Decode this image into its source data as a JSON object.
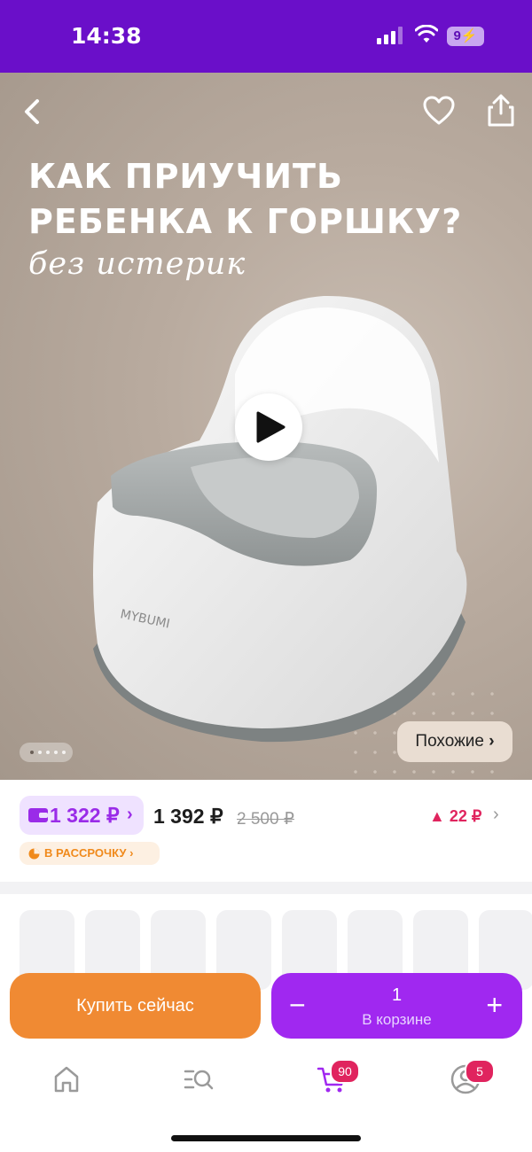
{
  "status_bar": {
    "time": "14:38",
    "battery": "9"
  },
  "hero": {
    "title": "КАК ПРИУЧИТЬ РЕБЕНКА К ГОРШКУ?",
    "subtitle": "без истерик",
    "brand_on_image": "MYBUMI",
    "similar_label": "Похожие",
    "pager_count": 5,
    "pager_active": 0
  },
  "price": {
    "wallet_price": "1 322 ₽",
    "current": "1 392 ₽",
    "old": "2 500 ₽",
    "delta": "22 ₽",
    "installment": "В РАССРОЧКУ"
  },
  "actions": {
    "buy_now": "Купить сейчас",
    "quantity": "1",
    "in_cart": "В корзине"
  },
  "tabbar": {
    "cart_badge": "90",
    "profile_badge": "5"
  },
  "colors": {
    "brand": "#6a0fc9",
    "accent_orange": "#f08a33",
    "accent_purple": "#a028f0",
    "alert": "#e0245e"
  }
}
